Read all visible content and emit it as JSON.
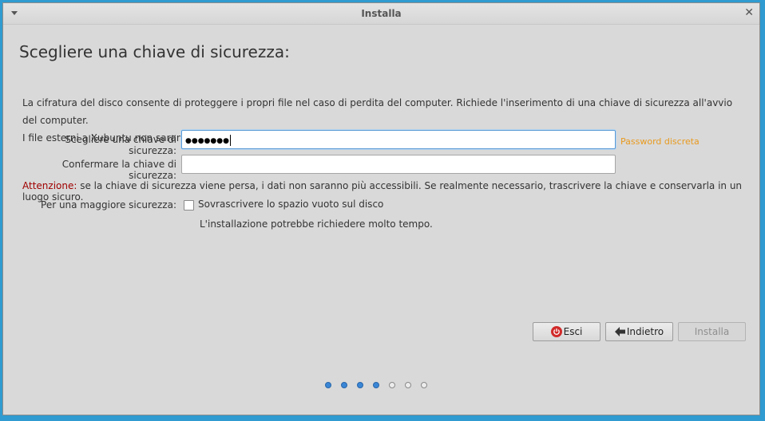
{
  "window": {
    "title": "Installa"
  },
  "page": {
    "heading": "Scegliere una chiave di sicurezza:",
    "description_line1": "La cifratura del disco consente di proteggere i propri file nel caso di perdita del computer. Richiede l'inserimento di una chiave di sicurezza all'avvio del computer.",
    "description_line2": "I file esterni a Xubuntu non saranno cifrati."
  },
  "form": {
    "key_label": "Scegliere una chiave di sicurezza:",
    "key_value": "●●●●●●●",
    "strength_text": "Password discreta",
    "confirm_label": "Confermare la chiave di sicurezza:",
    "confirm_value": "",
    "warning_prefix": "Attenzione:",
    "warning_text": " se la chiave di sicurezza viene persa, i dati non saranno più accessibili. Se realmente necessario, trascrivere la chiave e conservarla in un luogo sicuro.",
    "security_label": "Per una maggiore sicurezza:",
    "overwrite_label": "Sovrascrivere lo spazio vuoto sul disco",
    "overwrite_checked": false,
    "overwrite_note": "L'installazione potrebbe richiedere molto tempo."
  },
  "buttons": {
    "quit": "Esci",
    "back": "Indietro",
    "install": "Installa"
  },
  "progress": {
    "total_steps": 7,
    "completed_steps": 4
  },
  "colors": {
    "warning_label": "#a00000",
    "strength": "#e89a1f",
    "active_dot": "#3a86d6",
    "quit_icon": "#d12a2a"
  }
}
